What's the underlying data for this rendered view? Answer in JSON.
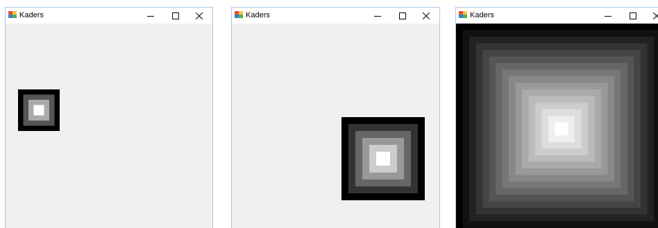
{
  "windows": [
    {
      "title": "Kaders",
      "levels": 4,
      "colors": [
        "#000000",
        "#555555",
        "#aaaaaa",
        "#ffffff"
      ]
    },
    {
      "title": "Kaders",
      "levels": 6,
      "colors": [
        "#000000",
        "#333333",
        "#666666",
        "#999999",
        "#cccccc",
        "#ffffff"
      ]
    },
    {
      "title": "Kaders",
      "levels": 16,
      "colors": [
        "#000000",
        "#111111",
        "#222222",
        "#333333",
        "#444444",
        "#555555",
        "#666666",
        "#777777",
        "#888888",
        "#999999",
        "#aaaaaa",
        "#bbbbbb",
        "#cccccc",
        "#dddddd",
        "#eeeeee",
        "#ffffff"
      ]
    }
  ],
  "icons": {
    "app": "app-icon",
    "minimize": "minimize-icon",
    "maximize": "maximize-icon",
    "close": "close-icon"
  },
  "theme": {
    "window_border": "#a9c6e8",
    "client_background": "#f0f0f0",
    "titlebar_background": "#ffffff"
  }
}
